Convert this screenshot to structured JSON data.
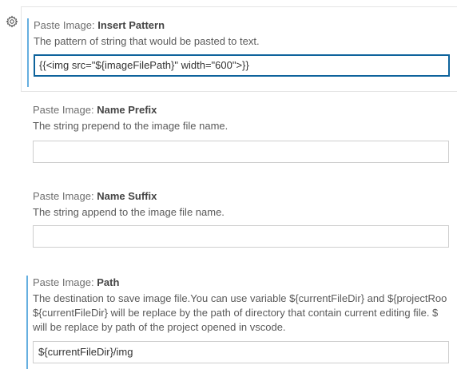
{
  "settings": [
    {
      "category": "Paste Image: ",
      "name": "Insert Pattern",
      "description": "The pattern of string that would be pasted to text.",
      "value": "{{<img src=\"${imageFilePath}\" width=\"600\">}}",
      "placeholder": ""
    },
    {
      "category": "Paste Image: ",
      "name": "Name Prefix",
      "description": "The string prepend to the image file name.",
      "value": "",
      "placeholder": ""
    },
    {
      "category": "Paste Image: ",
      "name": "Name Suffix",
      "description": "The string append to the image file name.",
      "value": "",
      "placeholder": ""
    },
    {
      "category": "Paste Image: ",
      "name": "Path",
      "description_lines": [
        "The destination to save image file.You can use variable ${currentFileDir} and ${projectRoo",
        "${currentFileDir} will be replace by the path of directory that contain current editing file. $",
        "will be replace by path of the project opened in vscode."
      ],
      "value": "${currentFileDir}/img",
      "placeholder": ""
    }
  ],
  "icons": {
    "gear": "gear-icon"
  },
  "colors": {
    "modified_indicator": "#66afe0",
    "focus_border": "#0e639c"
  }
}
